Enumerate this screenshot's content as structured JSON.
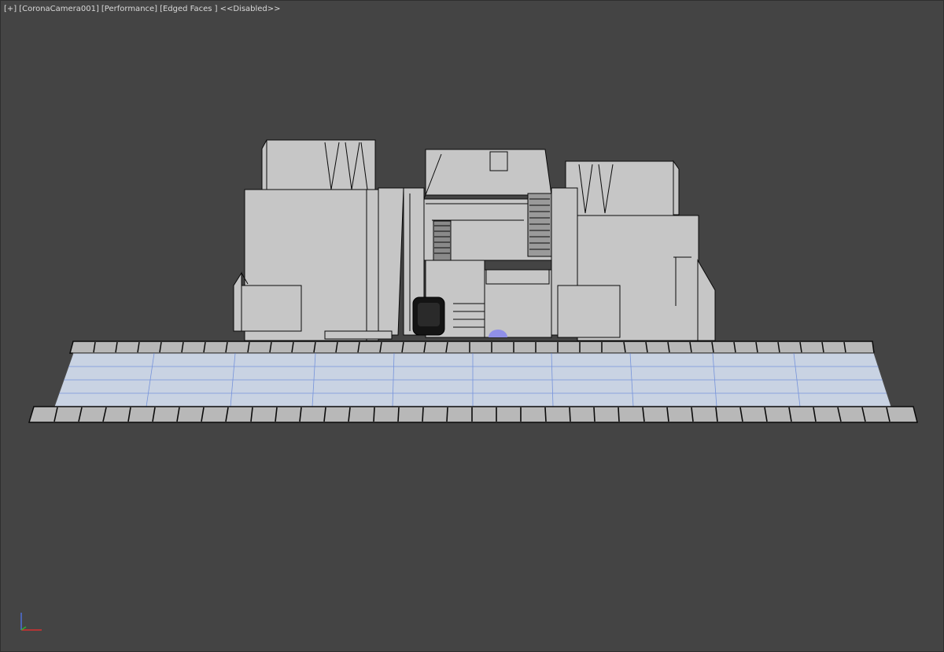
{
  "viewport": {
    "label_plus": "[+]",
    "label_camera": "[CoronaCamera001]",
    "label_shading": "[Performance]",
    "label_edged": "[Edged Faces ]",
    "label_disabled": "<<Disabled>>"
  },
  "colors": {
    "background": "#444444",
    "mesh_fill": "#c6c6c6",
    "mesh_edge": "#0a0a0a",
    "ground_fill": "#c9d3e3",
    "ground_grid": "#5b7ed8",
    "light_gizmo": "#8f8fe8"
  },
  "icons": {
    "axis_gizmo": "axis-tripod-icon"
  }
}
